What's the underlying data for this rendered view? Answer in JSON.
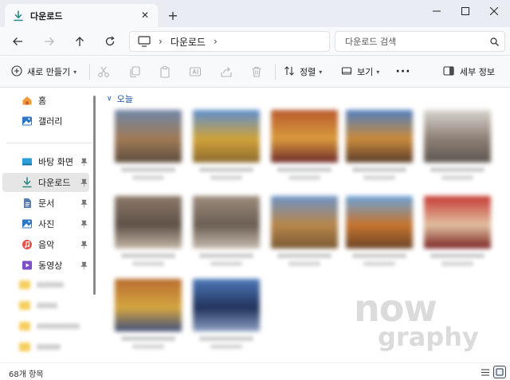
{
  "tab": {
    "title": "다운로드"
  },
  "address": {
    "location": "다운로드"
  },
  "search": {
    "placeholder": "다운로드 검색"
  },
  "toolbar": {
    "new_label": "새로 만들기",
    "sort_label": "정렬",
    "view_label": "보기",
    "details_label": "세부 정보"
  },
  "sidebar": {
    "items": [
      {
        "label": "홈",
        "icon": "home-icon"
      },
      {
        "label": "갤러리",
        "icon": "gallery-icon"
      },
      {
        "label": "바탕 화면",
        "icon": "desktop-icon"
      },
      {
        "label": "다운로드",
        "icon": "download-icon"
      },
      {
        "label": "문서",
        "icon": "document-icon"
      },
      {
        "label": "사진",
        "icon": "pictures-icon"
      },
      {
        "label": "음악",
        "icon": "music-icon"
      },
      {
        "label": "동영상",
        "icon": "video-icon"
      }
    ]
  },
  "content": {
    "group_label": "오늘",
    "thumbnails": [
      {
        "palette": [
          "#6f86a8",
          "#a07a56",
          "#5c4d3e"
        ]
      },
      {
        "palette": [
          "#5b8ed1",
          "#d0a23a",
          "#8c6a2e"
        ]
      },
      {
        "palette": [
          "#b85a2e",
          "#d99a3c",
          "#6d2a2a"
        ]
      },
      {
        "palette": [
          "#4f7fc1",
          "#c98a3a",
          "#5a3d2a"
        ]
      },
      {
        "palette": [
          "#d8d4cf",
          "#8d7f74",
          "#5e5650"
        ]
      },
      {
        "palette": [
          "#8c7a69",
          "#5f5147",
          "#c3b6a6"
        ]
      },
      {
        "palette": [
          "#9c8c7c",
          "#6b5e53",
          "#c7bbae"
        ]
      },
      {
        "palette": [
          "#6d93c7",
          "#b8864a",
          "#7a5a34"
        ]
      },
      {
        "palette": [
          "#6aa2d8",
          "#c7742f",
          "#6b4326"
        ]
      },
      {
        "palette": [
          "#c63a33",
          "#e1bfa0",
          "#7a2522"
        ]
      },
      {
        "palette": [
          "#b86b2e",
          "#d4a640",
          "#3f4f7a"
        ]
      },
      {
        "palette": [
          "#4e79b9",
          "#22335c",
          "#8da0c2"
        ]
      }
    ]
  },
  "status": {
    "count": "68개 항목"
  },
  "colors": {
    "accent": "#0f6cbd",
    "group_header": "#1f58a8",
    "tab_bg": "#e9edf3"
  }
}
